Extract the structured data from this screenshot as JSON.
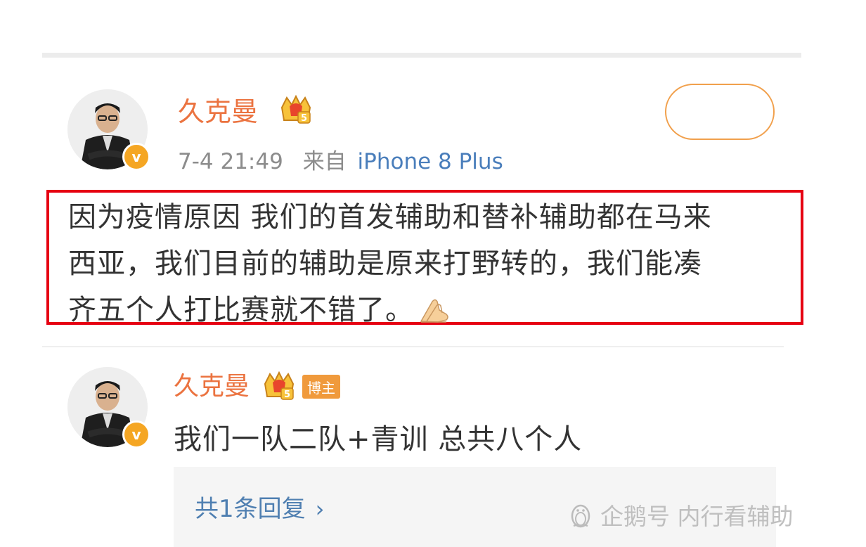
{
  "post": {
    "username": "久克曼",
    "time": "7-4 21:49",
    "from_label": "来自",
    "source": "iPhone 8 Plus",
    "text_lines": [
      "因为疫情原因 我们的首发辅助和替补辅助都在马来",
      "西亚，我们目前的辅助是原来打野转的，我们能凑",
      "齐五个人打比赛就不错了。"
    ],
    "emoji": "👌-hands-emoji",
    "follow_label": ""
  },
  "comment": {
    "username": "久克曼",
    "badge": "博主",
    "text": "我们一队二队+青训 总共八个人",
    "reply_link": "共1条回复"
  },
  "watermark": "企鹅号 内行看辅助",
  "icons": {
    "verified": "verified-v-icon",
    "vip_crown": "crown-vip-icon",
    "chevron": "chevron-right-icon",
    "penguin": "penguin-icon"
  },
  "colors": {
    "username": "#eb7340",
    "source_link": "#4a7ebb",
    "highlight_box": "#e60012",
    "follow_border": "#f1a04c",
    "verified_badge": "#f5a623",
    "author_badge": "#f09a3c"
  }
}
